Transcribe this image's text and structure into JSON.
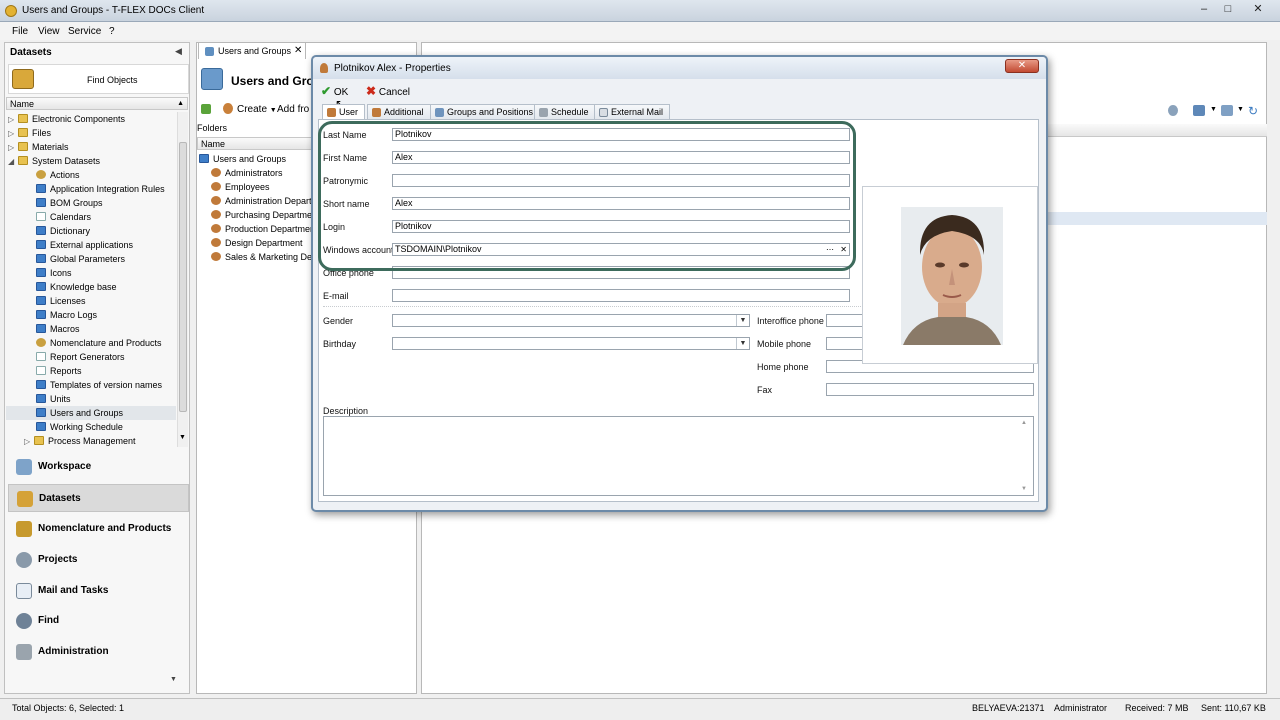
{
  "app": {
    "title": "Users and Groups - T-FLEX DOCs Client"
  },
  "menu": {
    "file": "File",
    "view": "View",
    "service": "Service",
    "help": "?"
  },
  "datasets_panel": {
    "title": "Datasets",
    "find_objects": "Find Objects",
    "column_name": "Name",
    "items": [
      {
        "label": "Electronic Components",
        "level": 1,
        "icon": "folder-icon",
        "expandable": true
      },
      {
        "label": "Files",
        "level": 1,
        "icon": "folder-icon",
        "expandable": true
      },
      {
        "label": "Materials",
        "level": 1,
        "icon": "folder-icon",
        "expandable": true
      },
      {
        "label": "System Datasets",
        "level": 1,
        "icon": "folder-icon",
        "expandable": true,
        "expanded": true
      },
      {
        "label": "Actions",
        "level": 2,
        "icon": "gear-icon"
      },
      {
        "label": "Application Integration Rules",
        "level": 2,
        "icon": "blue-icon"
      },
      {
        "label": "BOM Groups",
        "level": 2,
        "icon": "blue-icon"
      },
      {
        "label": "Calendars",
        "level": 2,
        "icon": "doc-icon"
      },
      {
        "label": "Dictionary",
        "level": 2,
        "icon": "blue-icon"
      },
      {
        "label": "External applications",
        "level": 2,
        "icon": "blue-icon"
      },
      {
        "label": "Global Parameters",
        "level": 2,
        "icon": "blue-icon"
      },
      {
        "label": "Icons",
        "level": 2,
        "icon": "blue-icon"
      },
      {
        "label": "Knowledge base",
        "level": 2,
        "icon": "blue-icon"
      },
      {
        "label": "Licenses",
        "level": 2,
        "icon": "blue-icon"
      },
      {
        "label": "Macro Logs",
        "level": 2,
        "icon": "blue-icon"
      },
      {
        "label": "Macros",
        "level": 2,
        "icon": "blue-icon"
      },
      {
        "label": "Nomenclature and Products",
        "level": 2,
        "icon": "gear-icon"
      },
      {
        "label": "Report Generators",
        "level": 2,
        "icon": "doc-icon"
      },
      {
        "label": "Reports",
        "level": 2,
        "icon": "doc-icon"
      },
      {
        "label": "Templates of version names",
        "level": 2,
        "icon": "blue-icon"
      },
      {
        "label": "Units",
        "level": 2,
        "icon": "blue-icon"
      },
      {
        "label": "Users and Groups",
        "level": 2,
        "icon": "blue-icon",
        "selected": true
      },
      {
        "label": "Working Schedule",
        "level": 2,
        "icon": "blue-icon"
      },
      {
        "label": "Process Management",
        "level": 2,
        "icon": "folder-icon",
        "expandable": true
      }
    ]
  },
  "nav": {
    "workspace": "Workspace",
    "datasets": "Datasets",
    "nomenclature": "Nomenclature and Products",
    "projects": "Projects",
    "mail": "Mail and Tasks",
    "find": "Find",
    "administration": "Administration"
  },
  "main_tab": {
    "label": "Users and Groups"
  },
  "main_header": {
    "title": "Users and Groups"
  },
  "toolbar": {
    "create": "Create",
    "add_from": "Add fro"
  },
  "folders": {
    "title": "Folders",
    "column_name": "Name",
    "root": "Users and Groups",
    "items": [
      "Administrators",
      "Employees",
      "Administration Departm",
      "Purchasing Department",
      "Production Department",
      "Design Department",
      "Sales & Marketing Depa"
    ]
  },
  "dialog": {
    "title": "Plotnikov Alex - Properties",
    "ok": "OK",
    "cancel": "Cancel",
    "tabs": [
      "User",
      "Additional",
      "Groups and Positions",
      "Schedule",
      "External Mail"
    ],
    "fields": {
      "last_name": {
        "label": "Last Name",
        "value": "Plotnikov"
      },
      "first_name": {
        "label": "First Name",
        "value": "Alex"
      },
      "patronymic": {
        "label": "Patronymic",
        "value": ""
      },
      "short_name": {
        "label": "Short name",
        "value": "Alex"
      },
      "login": {
        "label": "Login",
        "value": "Plotnikov"
      },
      "windows_account": {
        "label": "Windows account",
        "value": "TSDOMAIN\\Plotnikov"
      },
      "office_phone": {
        "label": "Office phone",
        "value": ""
      },
      "email": {
        "label": "E-mail",
        "value": ""
      },
      "gender": {
        "label": "Gender",
        "value": ""
      },
      "birthday": {
        "label": "Birthday",
        "value": ""
      },
      "interoffice_phone": {
        "label": "Interoffice phone",
        "value": ""
      },
      "mobile_phone": {
        "label": "Mobile phone",
        "value": ""
      },
      "home_phone": {
        "label": "Home phone",
        "value": ""
      },
      "fax": {
        "label": "Fax",
        "value": ""
      },
      "description": {
        "label": "Description",
        "value": ""
      }
    }
  },
  "status": {
    "total": "Total Objects: 6, Selected: 1",
    "user": "BELYAEVA:21371",
    "role": "Administrator",
    "received": "Received: 7 MB",
    "sent": "Sent: 110,67 KB"
  }
}
